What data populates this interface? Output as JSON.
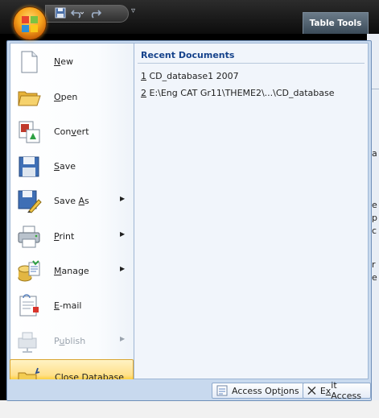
{
  "titlebar": {
    "table_tools": "Table Tools"
  },
  "quick_access": {
    "icons": [
      "save-icon",
      "undo-icon",
      "redo-icon",
      "customize-icon"
    ]
  },
  "menu": {
    "items": [
      {
        "name": "new",
        "label_pre": "",
        "label_key": "N",
        "label_post": "ew",
        "has_arrow": false,
        "enabled": true
      },
      {
        "name": "open",
        "label_pre": "",
        "label_key": "O",
        "label_post": "pen",
        "has_arrow": false,
        "enabled": true
      },
      {
        "name": "convert",
        "label_pre": "Con",
        "label_key": "v",
        "label_post": "ert",
        "has_arrow": false,
        "enabled": true
      },
      {
        "name": "save",
        "label_pre": "",
        "label_key": "S",
        "label_post": "ave",
        "has_arrow": false,
        "enabled": true
      },
      {
        "name": "save-as",
        "label_pre": "Save ",
        "label_key": "A",
        "label_post": "s",
        "has_arrow": true,
        "enabled": true
      },
      {
        "name": "print",
        "label_pre": "",
        "label_key": "P",
        "label_post": "rint",
        "has_arrow": true,
        "enabled": true
      },
      {
        "name": "manage",
        "label_pre": "",
        "label_key": "M",
        "label_post": "anage",
        "has_arrow": true,
        "enabled": true
      },
      {
        "name": "email",
        "label_pre": "",
        "label_key": "E",
        "label_post": "-mail",
        "has_arrow": false,
        "enabled": true
      },
      {
        "name": "publish",
        "label_pre": "P",
        "label_key": "u",
        "label_post": "blish",
        "has_arrow": true,
        "enabled": false
      },
      {
        "name": "close-database",
        "label_pre": "",
        "label_key": "C",
        "label_post": "lose Database",
        "has_arrow": false,
        "enabled": true
      }
    ],
    "arrow_glyph": "▶"
  },
  "recent": {
    "title": "Recent Documents",
    "docs": [
      {
        "num": "1",
        "text": " CD_database1 2007"
      },
      {
        "num": "2",
        "text": " E:\\Eng CAT Gr11\\THEME2\\...\\CD_database"
      }
    ]
  },
  "footer": {
    "options_pre": "Access Opt",
    "options_key": "i",
    "options_post": "ons",
    "exit_pre": "E",
    "exit_key": "x",
    "exit_post": "it Access"
  },
  "background_fragments": [
    "a",
    "e",
    "p",
    "c",
    "r",
    "e",
    "e",
    "r"
  ],
  "colors": {
    "accent": "#15428b",
    "highlight": "#ffd24a",
    "menu_bg": "#c8d9ee"
  }
}
